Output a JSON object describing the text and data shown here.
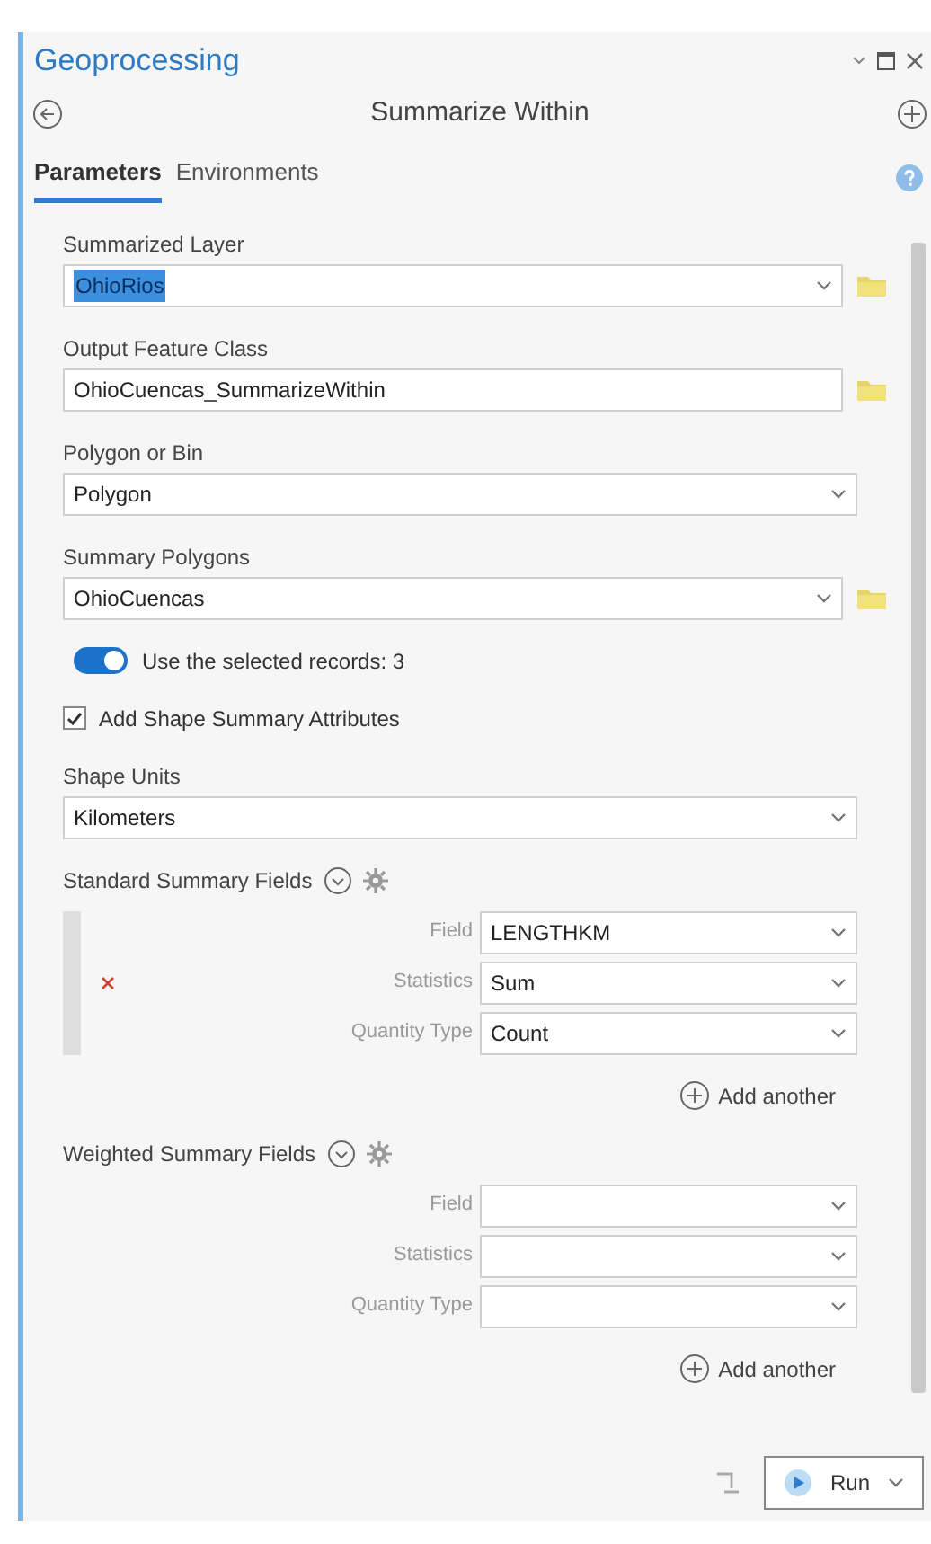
{
  "window": {
    "title": "Geoprocessing"
  },
  "tool": {
    "title": "Summarize Within"
  },
  "tabs": [
    {
      "label": "Parameters",
      "selected": true
    },
    {
      "label": "Environments",
      "selected": false
    }
  ],
  "parameters": [
    {
      "kind": "field",
      "label": "Summarized  Layer",
      "value": "OhioRios",
      "dropdown": true,
      "browse": true,
      "highlighted": true
    },
    {
      "kind": "field",
      "label": "Output  Feature Class",
      "value": "OhioCuencas_SummarizeWithin",
      "dropdown": false,
      "browse": true,
      "highlighted": false
    },
    {
      "kind": "field",
      "label": "Polygon or Bin",
      "value": "Polygon",
      "dropdown": true,
      "browse": false,
      "highlighted": false
    },
    {
      "kind": "field",
      "label": "Summary Polygons",
      "value": "OhioCuencas",
      "dropdown": true,
      "browse": true,
      "highlighted": false
    },
    {
      "kind": "toggle",
      "label": "Use the selected records: 3",
      "on": true
    },
    {
      "kind": "checkbox",
      "label": "Add Shape Summary Attributes",
      "checked": true
    },
    {
      "kind": "field",
      "label": "Shape Units",
      "value": "Kilometers",
      "dropdown": true,
      "browse": false,
      "highlighted": false
    },
    {
      "kind": "group",
      "label": "Standard Summary Fields",
      "removable": true,
      "add_label": "Add another",
      "rows": [
        {
          "label": "Field",
          "value": "LENGTHKM"
        },
        {
          "label": "Statistics",
          "value": "Sum"
        },
        {
          "label": "Quantity Type",
          "value": "Count"
        }
      ]
    },
    {
      "kind": "group",
      "label": "Weighted Summary Fields",
      "removable": false,
      "add_label": "Add another",
      "rows": [
        {
          "label": "Field"
        },
        {
          "label": "Statistics"
        },
        {
          "label": "Quantity Type"
        }
      ]
    }
  ],
  "run_button": {
    "label": "Run"
  }
}
